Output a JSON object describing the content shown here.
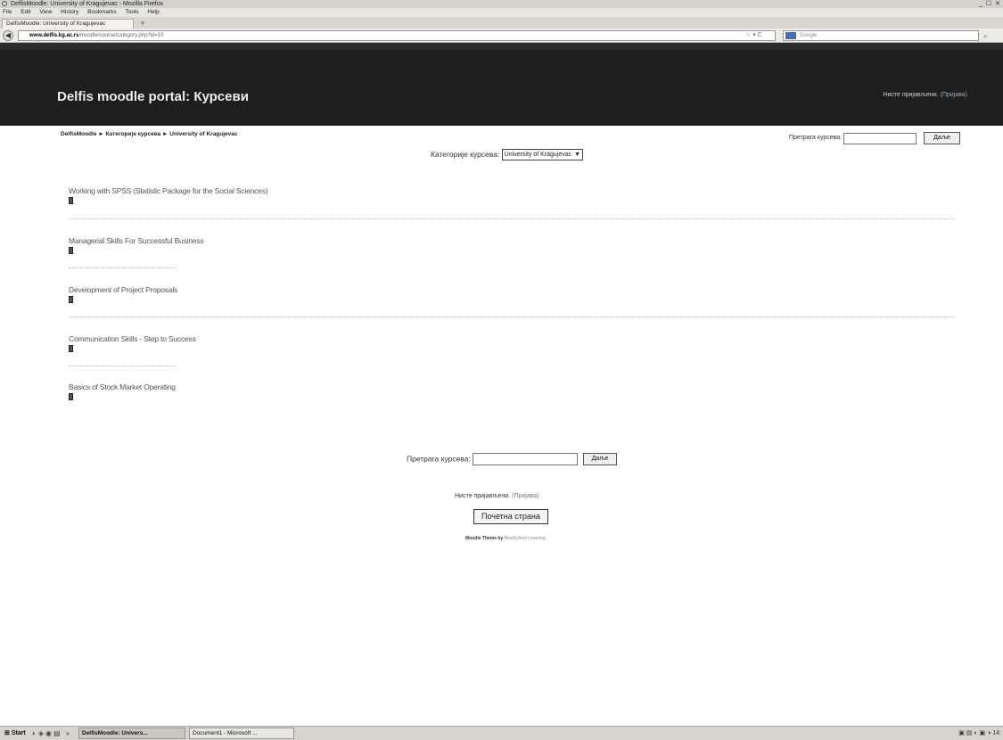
{
  "window": {
    "title": "DelfisMoodle: University of Kragujevac - Mozilla Firefox",
    "controls": "_ ☐ ✕"
  },
  "menu": [
    "File",
    "Edit",
    "View",
    "History",
    "Bookmarks",
    "Tools",
    "Help"
  ],
  "tab": {
    "label": "DelfisMoodle: University of Kragujevac",
    "new_tab": "+"
  },
  "nav": {
    "back": "◀",
    "url_host": "www.delfis.kg.ac.rs",
    "url_path": "/moodle/course/category.php?id=10",
    "url_tools": "☆ ▾ C",
    "search_placeholder": "Google"
  },
  "header": {
    "title": "Delfis moodle portal: Курсеви",
    "login_text": "Нисте пријављени.",
    "login_link": "(Пријава)"
  },
  "breadcrumb": "DelfisMoodle ► Категорије курсева ► University of Kragujevac",
  "search_top": {
    "label": "Претрага курсева:",
    "button": "Даље"
  },
  "category": {
    "label": "Категорије курсева:",
    "selected": "University of Kragujevac"
  },
  "courses": [
    "Working with SPSS (Statistic Package for the Social Sciences)",
    "Managerial Skills For Successful Business",
    "Development of Project Proposals",
    "Communication Skills - Step to Success",
    "Basics of Stock Market Operating"
  ],
  "search_bottom": {
    "label": "Претрага курсева:",
    "button": "Даље"
  },
  "footer": {
    "login_text": "Нисте пријављени.",
    "login_link": "(Пријава)",
    "home_button": "Почетна страна",
    "credit_prefix": "Moodle Theme by",
    "credit_link": "NewSchool Learning"
  },
  "taskbar": {
    "start": "Start",
    "tasks": [
      "DelfisMoodle: Univers...",
      "Document1 - Microsoft ..."
    ],
    "clock": "14:"
  }
}
